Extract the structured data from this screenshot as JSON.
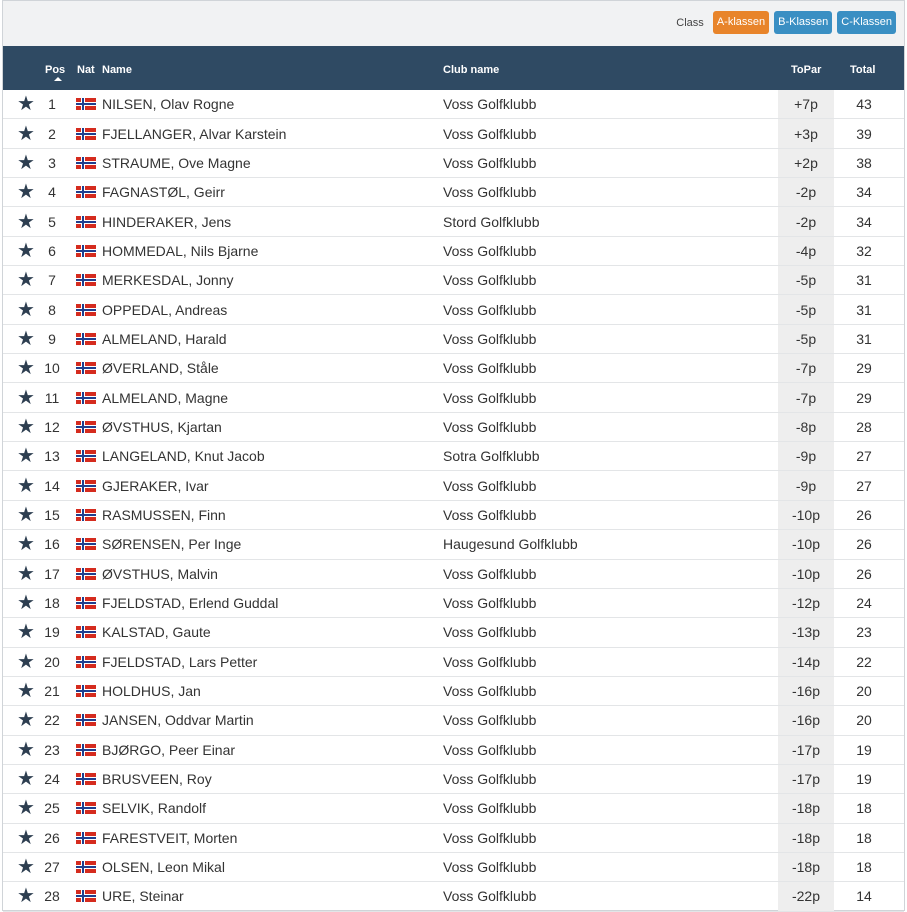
{
  "class_bar": {
    "label": "Class",
    "buttons": [
      "A-klassen",
      "B-Klassen",
      "C-Klassen"
    ],
    "active_color": "#e8842a",
    "inactive_color": "#3a8fc3"
  },
  "columns": {
    "pos": "Pos",
    "nat": "Nat",
    "name": "Name",
    "club": "Club name",
    "topar": "ToPar",
    "total": "Total"
  },
  "header_color": "#2f4a63",
  "rows": [
    {
      "pos": "1",
      "name": "NILSEN, Olav Rogne",
      "club": "Voss Golfklubb",
      "topar": "+7p",
      "total": "43"
    },
    {
      "pos": "2",
      "name": "FJELLANGER, Alvar Karstein",
      "club": "Voss Golfklubb",
      "topar": "+3p",
      "total": "39"
    },
    {
      "pos": "3",
      "name": "STRAUME, Ove Magne",
      "club": "Voss Golfklubb",
      "topar": "+2p",
      "total": "38"
    },
    {
      "pos": "4",
      "name": "FAGNASTØL, Geirr",
      "club": "Voss Golfklubb",
      "topar": "-2p",
      "total": "34"
    },
    {
      "pos": "5",
      "name": "HINDERAKER, Jens",
      "club": "Stord Golfklubb",
      "topar": "-2p",
      "total": "34"
    },
    {
      "pos": "6",
      "name": "HOMMEDAL, Nils Bjarne",
      "club": "Voss Golfklubb",
      "topar": "-4p",
      "total": "32"
    },
    {
      "pos": "7",
      "name": "MERKESDAL, Jonny",
      "club": "Voss Golfklubb",
      "topar": "-5p",
      "total": "31"
    },
    {
      "pos": "8",
      "name": "OPPEDAL, Andreas",
      "club": "Voss Golfklubb",
      "topar": "-5p",
      "total": "31"
    },
    {
      "pos": "9",
      "name": "ALMELAND, Harald",
      "club": "Voss Golfklubb",
      "topar": "-5p",
      "total": "31"
    },
    {
      "pos": "10",
      "name": "ØVERLAND, Ståle",
      "club": "Voss Golfklubb",
      "topar": "-7p",
      "total": "29"
    },
    {
      "pos": "11",
      "name": "ALMELAND, Magne",
      "club": "Voss Golfklubb",
      "topar": "-7p",
      "total": "29"
    },
    {
      "pos": "12",
      "name": "ØVSTHUS, Kjartan",
      "club": "Voss Golfklubb",
      "topar": "-8p",
      "total": "28"
    },
    {
      "pos": "13",
      "name": "LANGELAND, Knut Jacob",
      "club": "Sotra Golfklubb",
      "topar": "-9p",
      "total": "27"
    },
    {
      "pos": "14",
      "name": "GJERAKER, Ivar",
      "club": "Voss Golfklubb",
      "topar": "-9p",
      "total": "27"
    },
    {
      "pos": "15",
      "name": "RASMUSSEN, Finn",
      "club": "Voss Golfklubb",
      "topar": "-10p",
      "total": "26"
    },
    {
      "pos": "16",
      "name": "SØRENSEN, Per Inge",
      "club": "Haugesund Golfklubb",
      "topar": "-10p",
      "total": "26"
    },
    {
      "pos": "17",
      "name": "ØVSTHUS, Malvin",
      "club": "Voss Golfklubb",
      "topar": "-10p",
      "total": "26"
    },
    {
      "pos": "18",
      "name": "FJELDSTAD, Erlend Guddal",
      "club": "Voss Golfklubb",
      "topar": "-12p",
      "total": "24"
    },
    {
      "pos": "19",
      "name": "KALSTAD, Gaute",
      "club": "Voss Golfklubb",
      "topar": "-13p",
      "total": "23"
    },
    {
      "pos": "20",
      "name": "FJELDSTAD, Lars Petter",
      "club": "Voss Golfklubb",
      "topar": "-14p",
      "total": "22"
    },
    {
      "pos": "21",
      "name": "HOLDHUS, Jan",
      "club": "Voss Golfklubb",
      "topar": "-16p",
      "total": "20"
    },
    {
      "pos": "22",
      "name": "JANSEN, Oddvar Martin",
      "club": "Voss Golfklubb",
      "topar": "-16p",
      "total": "20"
    },
    {
      "pos": "23",
      "name": "BJØRGO, Peer Einar",
      "club": "Voss Golfklubb",
      "topar": "-17p",
      "total": "19"
    },
    {
      "pos": "24",
      "name": "BRUSVEEN, Roy",
      "club": "Voss Golfklubb",
      "topar": "-17p",
      "total": "19"
    },
    {
      "pos": "25",
      "name": "SELVIK, Randolf",
      "club": "Voss Golfklubb",
      "topar": "-18p",
      "total": "18"
    },
    {
      "pos": "26",
      "name": "FARESTVEIT, Morten",
      "club": "Voss Golfklubb",
      "topar": "-18p",
      "total": "18"
    },
    {
      "pos": "27",
      "name": "OLSEN, Leon Mikal",
      "club": "Voss Golfklubb",
      "topar": "-18p",
      "total": "18"
    },
    {
      "pos": "28",
      "name": "URE, Steinar",
      "club": "Voss Golfklubb",
      "topar": "-22p",
      "total": "14"
    }
  ]
}
